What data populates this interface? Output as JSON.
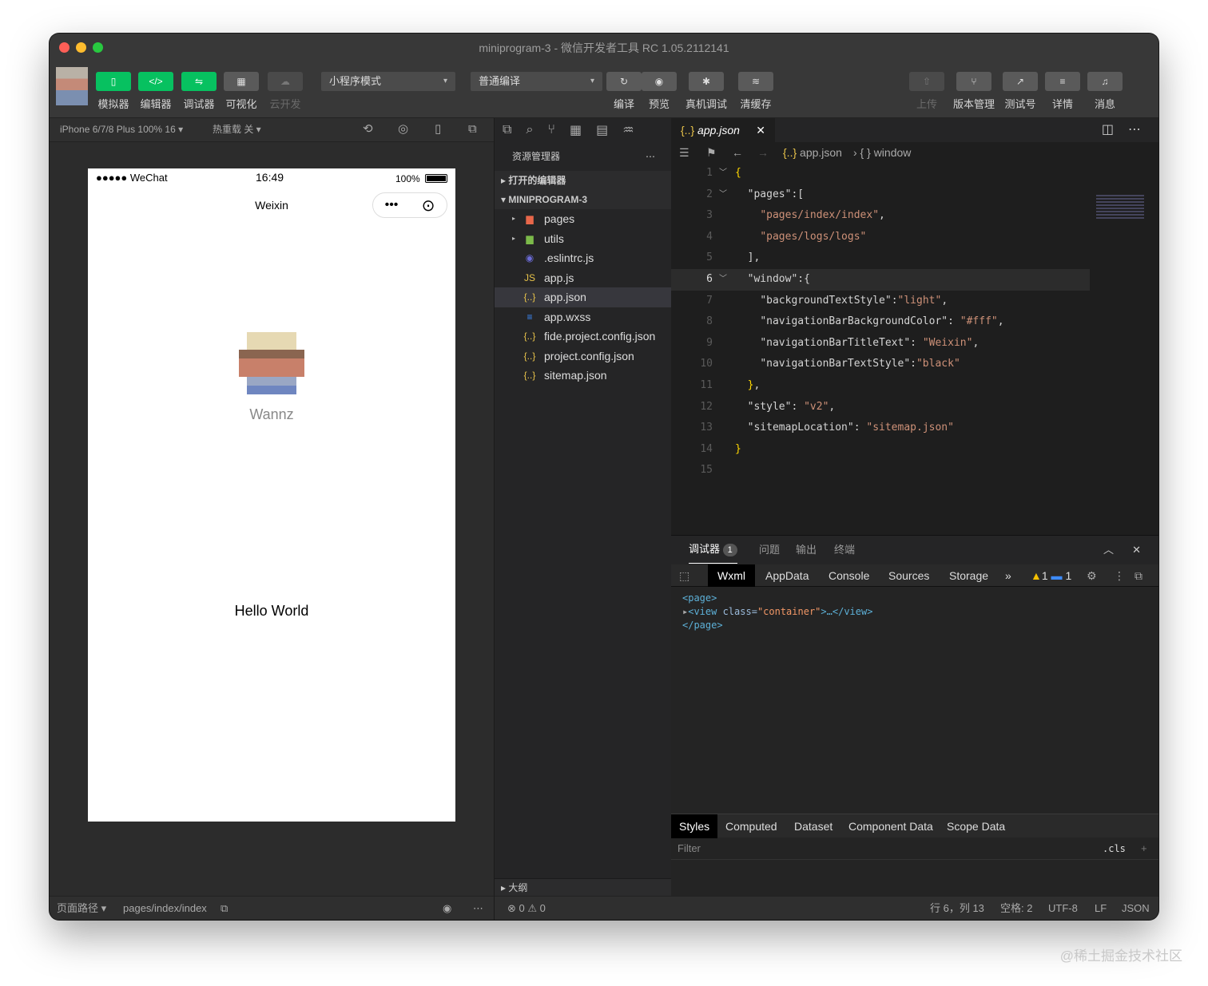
{
  "window": {
    "title": "miniprogram-3 - 微信开发者工具 RC 1.05.2112141"
  },
  "toolbar": {
    "simulator": "模拟器",
    "editor": "编辑器",
    "debugger": "调试器",
    "visual": "可视化",
    "cloud": "云开发",
    "mode_select": "小程序模式",
    "compile_select": "普通编译",
    "compile": "编译",
    "preview": "预览",
    "remote_debug": "真机调试",
    "clear_cache": "清缓存",
    "upload": "上传",
    "version": "版本管理",
    "test": "测试号",
    "details": "详情",
    "messages": "消息"
  },
  "sim": {
    "device": "iPhone 6/7/8 Plus 100% 16 ▾",
    "hot_reload": "热重载 关 ▾",
    "carrier": "●●●●● WeChat",
    "time": "16:49",
    "battery": "100%",
    "nav_title": "Weixin",
    "nickname": "Wannz",
    "hello": "Hello World",
    "footer_path_label": "页面路径 ▾",
    "footer_path": "pages/index/index"
  },
  "explorer": {
    "title": "资源管理器",
    "open_editors": "打开的编辑器",
    "project": "MINIPROGRAM-3",
    "files": [
      {
        "name": "pages",
        "icon": "folder-icon"
      },
      {
        "name": "utils",
        "icon": "folder-icon"
      },
      {
        "name": ".eslintrc.js",
        "icon": "eslint-icon"
      },
      {
        "name": "app.js",
        "icon": "js-icon"
      },
      {
        "name": "app.json",
        "icon": "json-icon"
      },
      {
        "name": "app.wxss",
        "icon": "css-icon"
      },
      {
        "name": "fide.project.config.json",
        "icon": "json-icon"
      },
      {
        "name": "project.config.json",
        "icon": "json-icon"
      },
      {
        "name": "sitemap.json",
        "icon": "json-icon"
      }
    ],
    "outline": "大纲",
    "errors": "0",
    "warnings": "0"
  },
  "editor": {
    "tab": "app.json",
    "crumb_file": "app.json",
    "crumb_symbol": "window",
    "lines": [
      "1",
      "2",
      "3",
      "4",
      "5",
      "6",
      "7",
      "8",
      "9",
      "10",
      "11",
      "12",
      "13",
      "14",
      "15"
    ],
    "code": [
      "{",
      "  \"pages\":[",
      "    \"pages/index/index\",",
      "    \"pages/logs/logs\"",
      "  ],",
      "  \"window\":{",
      "    \"backgroundTextStyle\":\"light\",",
      "    \"navigationBarBackgroundColor\": \"#fff\",",
      "    \"navigationBarTitleText\": \"Weixin\",",
      "    \"navigationBarTextStyle\":\"black\"",
      "  },",
      "  \"style\": \"v2\",",
      "  \"sitemapLocation\": \"sitemap.json\"",
      "}",
      ""
    ]
  },
  "debugger": {
    "tab_debugger": "调试器",
    "badge": "1",
    "tab_problems": "问题",
    "tab_output": "输出",
    "tab_terminal": "终端",
    "devtabs": [
      "Wxml",
      "AppData",
      "Console",
      "Sources",
      "Storage"
    ],
    "more": "»",
    "warn_count": "1",
    "info_count": "1",
    "dom_page_open": "<page>",
    "dom_view_tag": "<view",
    "dom_view_attr": " class=",
    "dom_view_val": "\"container\"",
    "dom_view_close": ">…</view>",
    "dom_page_close": "</page>",
    "style_tabs": [
      "Styles",
      "Computed",
      "Dataset",
      "Component Data",
      "Scope Data"
    ],
    "filter_placeholder": "Filter",
    "cls": ".cls",
    "plus": "+"
  },
  "status": {
    "position": "行 6，列 13",
    "spaces": "空格: 2",
    "encoding": "UTF-8",
    "eol": "LF",
    "language": "JSON"
  },
  "watermark": "@稀土掘金技术社区"
}
